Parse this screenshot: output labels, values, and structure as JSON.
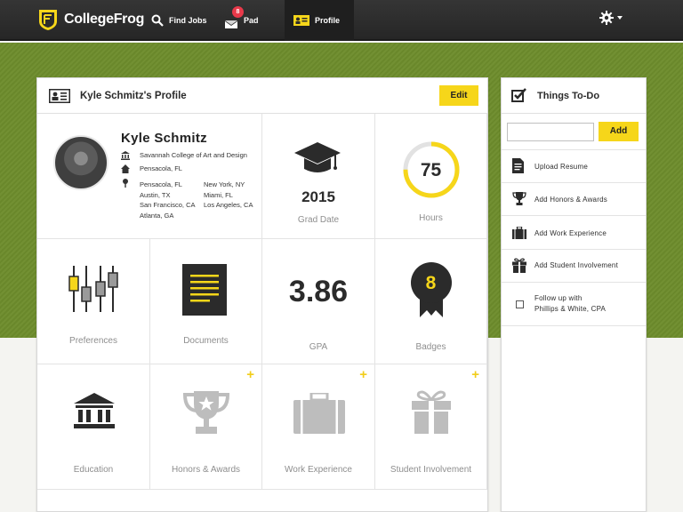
{
  "nav": {
    "brand": "CollegeFrog",
    "find_jobs": "Find Jobs",
    "pad": "Pad",
    "pad_badge": "8",
    "profile": "Profile",
    "settings_icon": "gear-icon"
  },
  "colors": {
    "accent": "#f6d61a",
    "green": "#6d8c2c",
    "nav_bg": "#2b2b2b",
    "badge": "#e8394a"
  },
  "profile": {
    "title": "Kyle Schmitz's Profile",
    "edit_label": "Edit",
    "name": "Kyle Schmitz",
    "school": "Savannah College of Art and Design",
    "hometown": "Pensacola, FL",
    "locations_col1": [
      "Pensacola, FL",
      "Austin, TX",
      "San Francisco, CA",
      "Atlanta, GA"
    ],
    "locations_col2": [
      "New York, NY",
      "Miami, FL",
      "Los Angeles, CA"
    ]
  },
  "stats": {
    "grad_year": "2015",
    "grad_label": "Grad Date",
    "hours": "75",
    "hours_label": "Hours",
    "hours_progress": 0.75,
    "gpa": "3.86",
    "gpa_label": "GPA",
    "badges": "8",
    "badges_label": "Badges"
  },
  "tiles": {
    "preferences": "Preferences",
    "documents": "Documents",
    "education": "Education",
    "honors": "Honors & Awards",
    "work": "Work Experience",
    "involvement": "Student Involvement",
    "plus": "+"
  },
  "todo": {
    "title": "Things To-Do",
    "input_placeholder": "",
    "add_label": "Add",
    "items": [
      {
        "label": "Upload Resume",
        "icon": "document-icon"
      },
      {
        "label": "Add Honors & Awards",
        "icon": "trophy-icon"
      },
      {
        "label": "Add Work Experience",
        "icon": "briefcase-icon"
      },
      {
        "label": "Add Student Involvement",
        "icon": "gift-icon"
      }
    ],
    "followup_line1": "Follow up with",
    "followup_line2": "Phillips & White, CPA"
  }
}
